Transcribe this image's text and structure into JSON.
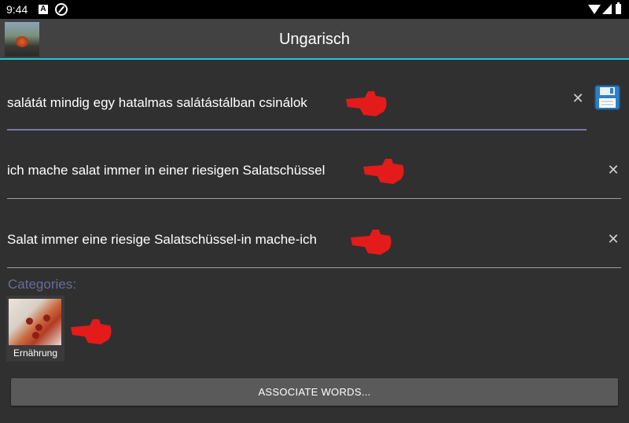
{
  "status_bar": {
    "time": "9:44",
    "notification_letter": "A"
  },
  "app_bar": {
    "title": "Ungarisch",
    "accent": "#26c6da"
  },
  "fields": [
    {
      "text": "salátát mindig egy hatalmas salátástálban csinálok",
      "clear_icon": "close-icon",
      "focused": true
    },
    {
      "text": "ich mache salat immer in einer riesigen Salatschüssel",
      "clear_icon": "close-icon",
      "focused": false
    },
    {
      "text": "Salat immer eine riesige Salatschüssel-in mache-ich",
      "clear_icon": "close-icon",
      "focused": false
    }
  ],
  "save_icon": "floppy-disk-icon",
  "pointer_icon": "pointing-hand-icon",
  "categories": {
    "label": "Categories:",
    "items": [
      {
        "caption": "Ernährung",
        "image": "pizza-slice"
      }
    ]
  },
  "associate_button": {
    "label": "ASSOCIATE WORDS..."
  },
  "colors": {
    "background": "#303030",
    "appbar": "#424242",
    "category_label": "#6c6b9a",
    "hand": "#e31b1b"
  }
}
